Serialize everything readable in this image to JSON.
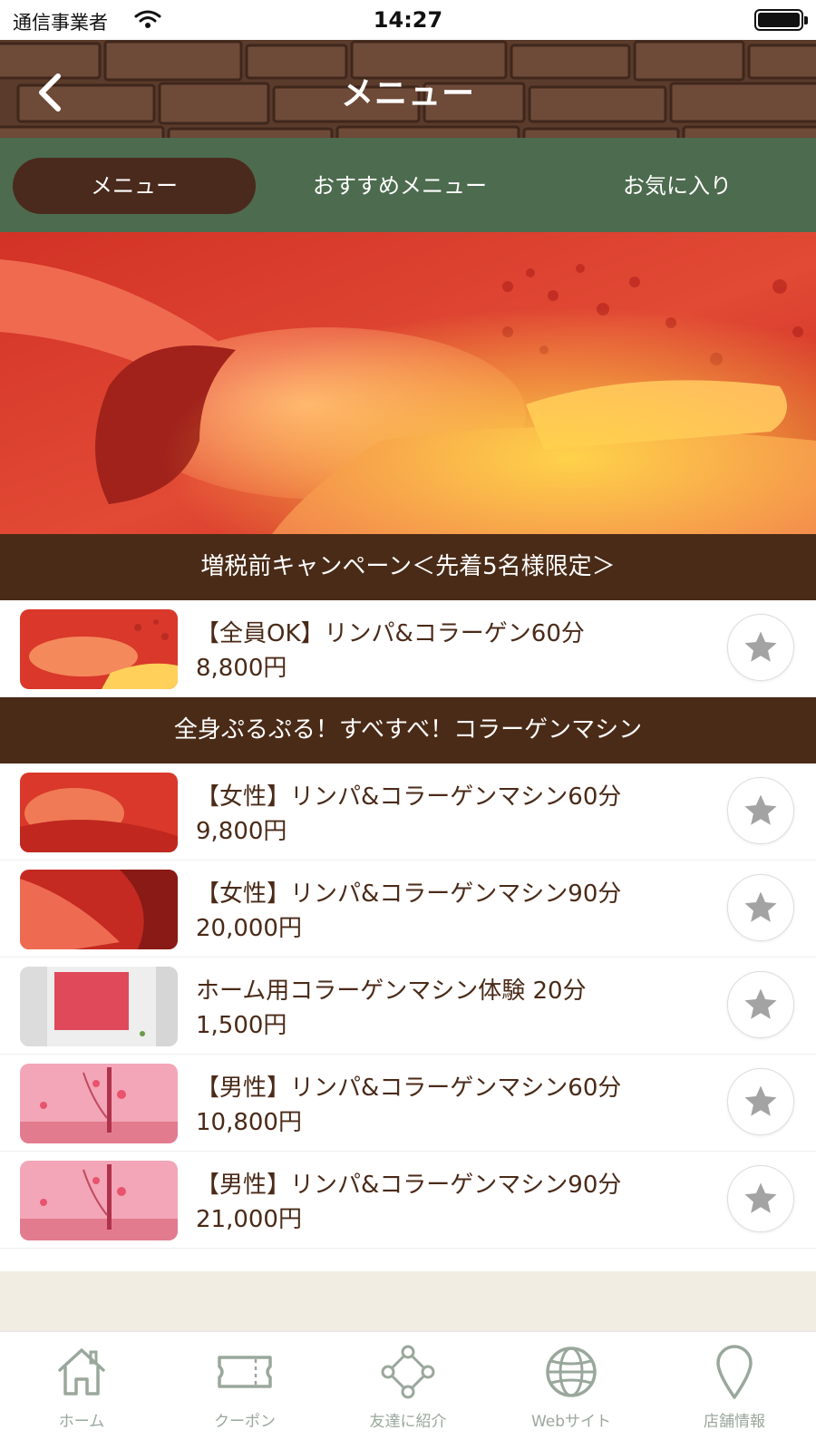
{
  "status_bar": {
    "carrier": "通信事業者",
    "time": "14:27"
  },
  "header": {
    "title": "メニュー",
    "back_icon": "chevron-left-icon"
  },
  "tabs": [
    {
      "label": "メニュー",
      "active": true
    },
    {
      "label": "おすすめメニュー",
      "active": false
    },
    {
      "label": "お気に入り",
      "active": false
    }
  ],
  "sections": [
    {
      "title": "増税前キャンペーン＜先着5名様限定＞",
      "items": [
        {
          "name": "【全員OK】リンパ&コラーゲン60分",
          "price": "8,800円"
        }
      ]
    },
    {
      "title": "全身ぷるぷる！すべすべ！コラーゲンマシン",
      "items": [
        {
          "name": "【女性】リンパ&コラーゲンマシン60分",
          "price": "9,800円"
        },
        {
          "name": "【女性】リンパ&コラーゲンマシン90分",
          "price": "20,000円"
        },
        {
          "name": "ホーム用コラーゲンマシン体験 20分",
          "price": "1,500円"
        },
        {
          "name": "【男性】リンパ&コラーゲンマシン60分",
          "price": "10,800円"
        },
        {
          "name": "【男性】リンパ&コラーゲンマシン90分",
          "price": "21,000円"
        }
      ]
    }
  ],
  "bottom_nav": [
    {
      "label": "ホーム",
      "icon": "home-icon"
    },
    {
      "label": "クーポン",
      "icon": "ticket-icon"
    },
    {
      "label": "友達に紹介",
      "icon": "share-icon"
    },
    {
      "label": "Webサイト",
      "icon": "globe-icon"
    },
    {
      "label": "店舗情報",
      "icon": "map-pin-icon"
    }
  ],
  "colors": {
    "header_brown": "#5a3a2a",
    "tab_green": "#4d6b4f",
    "active_tab": "#4a2a1d",
    "section_brown": "#4a2b17",
    "nav_green": "#9aa89c",
    "star_gray": "#a3a3a3"
  }
}
